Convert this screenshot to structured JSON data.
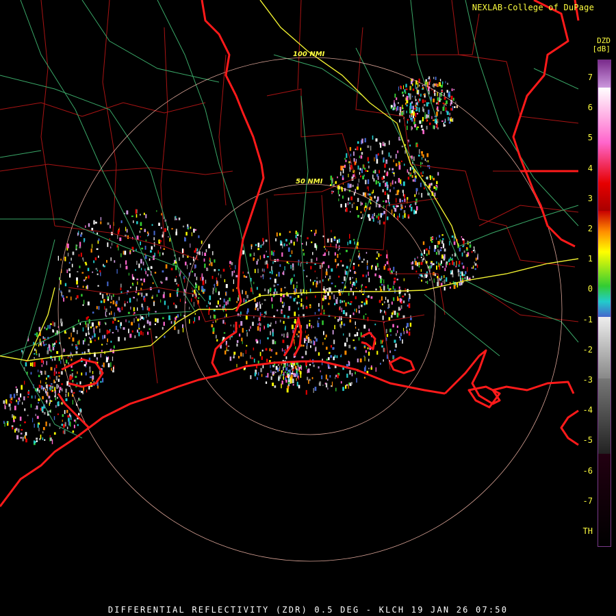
{
  "header": {
    "credit": "NEXLAB-College of DuPage"
  },
  "footer": {
    "caption": "DIFFERENTIAL REFLECTIVITY (ZDR) 0.5 DEG - KLCH 19 JAN 26 07:50"
  },
  "legend": {
    "product": "DZD",
    "unit": "[dB]",
    "ticks": [
      "7",
      "6",
      "5",
      "4",
      "3",
      "2",
      "1",
      "0",
      "-1",
      "-2",
      "-3",
      "-4",
      "-5",
      "-6",
      "-7",
      "TH"
    ],
    "colors": {
      "top": "#ffffff",
      "purple": "#7a2b8c",
      "pink": "#ff66cc",
      "red": "#e60000",
      "orange": "#ff8c00",
      "yellow": "#ffff00",
      "green": "#33cc33",
      "cyan": "#22cccc",
      "blue": "#4466cc",
      "gray": "#cccccc",
      "black": "#000000"
    }
  },
  "map": {
    "range_rings": [
      "50 NMI",
      "100 NMI"
    ],
    "colors": {
      "coastline": "#ff1a1a",
      "county_lines": "#aa1414",
      "roads": "#3aa868",
      "interstate": "#f0f030",
      "ring": "#ffc0b0"
    }
  }
}
